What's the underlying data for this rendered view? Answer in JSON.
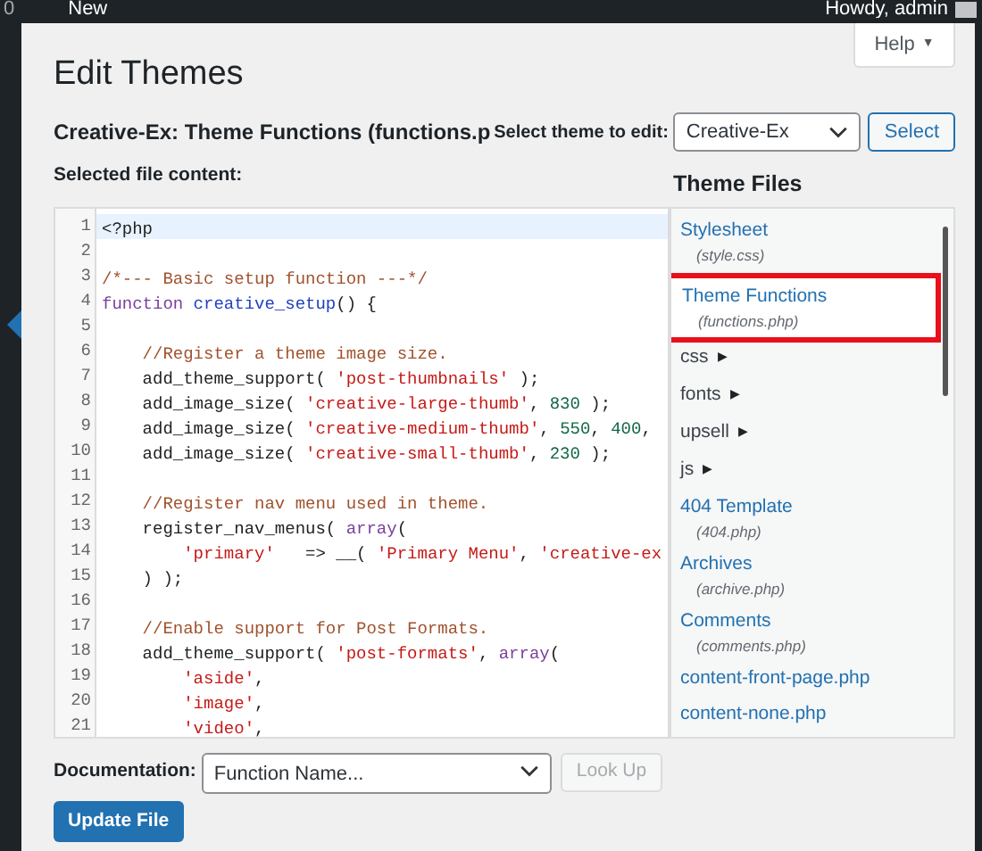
{
  "admin_bar": {
    "comments_count": "0",
    "new_label": "New",
    "greeting": "Howdy, admin"
  },
  "help_tab": {
    "label": "Help",
    "arrow": "▼"
  },
  "page_title": "Edit Themes",
  "file_heading": "Creative-Ex: Theme Functions (functions.p",
  "theme_select": {
    "label": "Select theme to edit:",
    "value": "Creative-Ex",
    "button": "Select"
  },
  "editor": {
    "label": "Selected file content:",
    "lines": [
      {
        "number": "1",
        "current": true,
        "tokens": [
          {
            "kind": "plain",
            "text": "<?php"
          }
        ]
      },
      {
        "number": "2",
        "current": false
      },
      {
        "number": "3",
        "current": false,
        "tokens": [
          {
            "kind": "comment",
            "text": "/*--- Basic setup function ---*/"
          }
        ]
      },
      {
        "number": "4",
        "current": false,
        "tokens": [
          {
            "kind": "keyword",
            "text": "function"
          },
          {
            "kind": "func",
            "text": " creative_setup"
          },
          {
            "kind": "plain",
            "text": "() {"
          }
        ]
      },
      {
        "number": "5",
        "current": false
      },
      {
        "number": "6",
        "current": false,
        "tokens": [
          {
            "kind": "comment",
            "text": "    //Register a theme image size."
          }
        ]
      },
      {
        "number": "7",
        "current": false,
        "tokens": [
          {
            "kind": "plain",
            "text": "    add_theme_support( "
          },
          {
            "kind": "string",
            "text": "'post-thumbnails'"
          },
          {
            "kind": "plain",
            "text": " );"
          }
        ]
      },
      {
        "number": "8",
        "current": false,
        "tokens": [
          {
            "kind": "plain",
            "text": "    add_image_size( "
          },
          {
            "kind": "string",
            "text": "'creative-large-thumb'"
          },
          {
            "kind": "plain",
            "text": ", "
          },
          {
            "kind": "number",
            "text": "830"
          },
          {
            "kind": "plain",
            "text": " );"
          }
        ]
      },
      {
        "number": "9",
        "current": false,
        "tokens": [
          {
            "kind": "plain",
            "text": "    add_image_size( "
          },
          {
            "kind": "string",
            "text": "'creative-medium-thumb'"
          },
          {
            "kind": "plain",
            "text": ", "
          },
          {
            "kind": "number",
            "text": "550"
          },
          {
            "kind": "plain",
            "text": ", "
          },
          {
            "kind": "number",
            "text": "400"
          },
          {
            "kind": "plain",
            "text": ","
          }
        ]
      },
      {
        "number": "10",
        "current": false,
        "tokens": [
          {
            "kind": "plain",
            "text": "    add_image_size( "
          },
          {
            "kind": "string",
            "text": "'creative-small-thumb'"
          },
          {
            "kind": "plain",
            "text": ", "
          },
          {
            "kind": "number",
            "text": "230"
          },
          {
            "kind": "plain",
            "text": " );"
          }
        ]
      },
      {
        "number": "11",
        "current": false
      },
      {
        "number": "12",
        "current": false,
        "tokens": [
          {
            "kind": "comment",
            "text": "    //Register nav menu used in theme."
          }
        ]
      },
      {
        "number": "13",
        "current": false,
        "tokens": [
          {
            "kind": "plain",
            "text": "    register_nav_menus( "
          },
          {
            "kind": "keyword",
            "text": "array"
          },
          {
            "kind": "plain",
            "text": "("
          }
        ]
      },
      {
        "number": "14",
        "current": false,
        "tokens": [
          {
            "kind": "string",
            "text": "        'primary'"
          },
          {
            "kind": "plain",
            "text": "   => __( "
          },
          {
            "kind": "string",
            "text": "'Primary Menu'"
          },
          {
            "kind": "plain",
            "text": ", "
          },
          {
            "kind": "string",
            "text": "'creative-ex"
          }
        ]
      },
      {
        "number": "15",
        "current": false,
        "tokens": [
          {
            "kind": "plain",
            "text": "    ) );"
          }
        ]
      },
      {
        "number": "16",
        "current": false
      },
      {
        "number": "17",
        "current": false,
        "tokens": [
          {
            "kind": "comment",
            "text": "    //Enable support for Post Formats."
          }
        ]
      },
      {
        "number": "18",
        "current": false,
        "tokens": [
          {
            "kind": "plain",
            "text": "    add_theme_support( "
          },
          {
            "kind": "string",
            "text": "'post-formats'"
          },
          {
            "kind": "plain",
            "text": ", "
          },
          {
            "kind": "keyword",
            "text": "array"
          },
          {
            "kind": "plain",
            "text": "("
          }
        ]
      },
      {
        "number": "19",
        "current": false,
        "tokens": [
          {
            "kind": "string",
            "text": "        'aside'"
          },
          {
            "kind": "plain",
            "text": ","
          }
        ]
      },
      {
        "number": "20",
        "current": false,
        "tokens": [
          {
            "kind": "string",
            "text": "        'image'"
          },
          {
            "kind": "plain",
            "text": ","
          }
        ]
      },
      {
        "number": "21",
        "current": false,
        "tokens": [
          {
            "kind": "string",
            "text": "        'video'"
          },
          {
            "kind": "plain",
            "text": ","
          }
        ]
      }
    ]
  },
  "theme_files": {
    "title": "Theme Files",
    "items": [
      {
        "kind": "file",
        "name": "Stylesheet",
        "filename": "(style.css)",
        "selected": false,
        "highlighted": false
      },
      {
        "kind": "file",
        "name": "Theme Functions",
        "filename": "(functions.php)",
        "selected": true,
        "highlighted": true
      },
      {
        "kind": "folder",
        "name": "css",
        "arrow": "▶"
      },
      {
        "kind": "folder",
        "name": "fonts",
        "arrow": "▶"
      },
      {
        "kind": "folder",
        "name": "upsell",
        "arrow": "▶"
      },
      {
        "kind": "folder",
        "name": "js",
        "arrow": "▶"
      },
      {
        "kind": "file",
        "name": "404 Template",
        "filename": "(404.php)",
        "selected": false,
        "highlighted": false
      },
      {
        "kind": "file",
        "name": "Archives",
        "filename": "(archive.php)",
        "selected": false,
        "highlighted": false
      },
      {
        "kind": "file",
        "name": "Comments",
        "filename": "(comments.php)",
        "selected": false,
        "highlighted": false
      },
      {
        "kind": "file",
        "name": "content-front-page.php",
        "selected": false,
        "highlighted": false
      },
      {
        "kind": "file",
        "name": "content-none.php",
        "selected": false,
        "highlighted": false
      }
    ]
  },
  "documentation": {
    "label": "Documentation:",
    "placeholder": "Function Name...",
    "button": "Look Up",
    "button_disabled": true
  },
  "update_button": "Update File"
}
